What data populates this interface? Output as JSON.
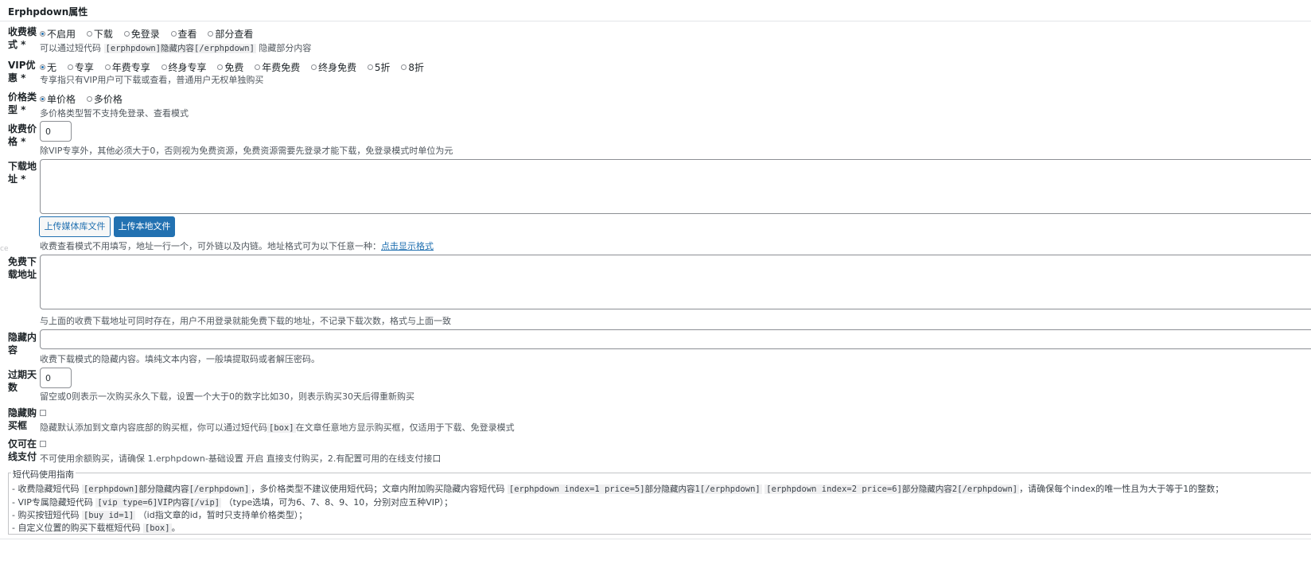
{
  "panel": {
    "title": "Erphpdown属性",
    "edge_mark": "ce"
  },
  "fee_mode": {
    "label_1": "收费模",
    "label_2": "式 *",
    "options": [
      "不启用",
      "下载",
      "免登录",
      "查看",
      "部分查看"
    ],
    "selected": 0,
    "desc_prefix": "可以通过短代码",
    "desc_code": "[erphpdown]隐藏内容[/erphpdown]",
    "desc_suffix": "隐藏部分内容"
  },
  "vip_discount": {
    "label_1": "VIP优",
    "label_2": "惠 *",
    "options": [
      "无",
      "专享",
      "年费专享",
      "终身专享",
      "免费",
      "年费免费",
      "终身免费",
      "5折",
      "8折"
    ],
    "selected": 0,
    "desc": "专享指只有VIP用户可下载或查看，普通用户无权单独购买"
  },
  "price_type": {
    "label_1": "价格类",
    "label_2": "型 *",
    "options": [
      "单价格",
      "多价格"
    ],
    "selected": 0,
    "desc": "多价格类型暂不支持免登录、查看模式"
  },
  "fee_price": {
    "label_1": "收费价",
    "label_2": "格 *",
    "value": "0",
    "desc": "除VIP专享外，其他必须大于0，否则视为免费资源，免费资源需要先登录才能下载，免登录模式时单位为元"
  },
  "download_url": {
    "label_1": "下载地",
    "label_2": "址 *",
    "value": "",
    "upload_media_label": "上传媒体库文件",
    "upload_local_label": "上传本地文件",
    "desc": "收费查看模式不用填写，地址一行一个，可外链以及内链。地址格式可为以下任意一种：",
    "desc_link": "点击显示格式"
  },
  "free_download_url": {
    "label_1": "免费下",
    "label_2": "载地址",
    "value": "",
    "desc": "与上面的收费下载地址可同时存在，用户不用登录就能免费下载的地址，不记录下载次数，格式与上面一致"
  },
  "hidden_content": {
    "label_1": "隐藏内",
    "label_2": "容",
    "value": "",
    "desc": "收费下载模式的隐藏内容。填纯文本内容，一般填提取码或者解压密码。"
  },
  "expire_days": {
    "label_1": "过期天",
    "label_2": "数",
    "value": "0",
    "desc": "留空或0则表示一次购买永久下载，设置一个大于0的数字比如30，则表示购买30天后得重新购买"
  },
  "hide_buy_box": {
    "label_1": "隐藏购",
    "label_2": "买框",
    "checked": false,
    "desc_prefix": "隐藏默认添加到文章内容底部的购买框，你可以通过短代码",
    "desc_code": "[box]",
    "desc_suffix": "在文章任意地方显示购买框，仅适用于下载、免登录模式"
  },
  "online_pay_only": {
    "label_1": "仅可在",
    "label_2": "线支付",
    "checked": false,
    "desc": "不可使用余额购买，请确保 1.erphpdown-基础设置 开启 直接支付购买，2.有配置可用的在线支付接口"
  },
  "shortcode_guide": {
    "title": "短代码使用指南",
    "line1": {
      "t1": "- 收费隐藏短代码",
      "c1": "[erphpdown]部分隐藏内容[/erphpdown]",
      "t2": "，多价格类型不建议使用短代码；文章内附加购买隐藏内容短代码",
      "c2": "[erphpdown index=1 price=5]部分隐藏内容1[/erphpdown]",
      "c3": "[erphpdown index=2 price=6]部分隐藏内容2[/erphpdown]",
      "t3": "，请确保每个index的唯一性且为大于等于1的整数；"
    },
    "line2": {
      "t1": "- VIP专属隐藏短代码",
      "c1": "[vip type=6]VIP内容[/vip]",
      "t2": "（type选填，可为6、7、8、9、10，分别对应五种VIP）；"
    },
    "line3": {
      "t1": "- 购买按钮短代码",
      "c1": "[buy id=1]",
      "t2": "（id指文章的id，暂时只支持单价格类型）；"
    },
    "line4": {
      "t1": "- 自定义位置的购买下载框短代码",
      "c1": "[box]",
      "t2": "。"
    }
  }
}
